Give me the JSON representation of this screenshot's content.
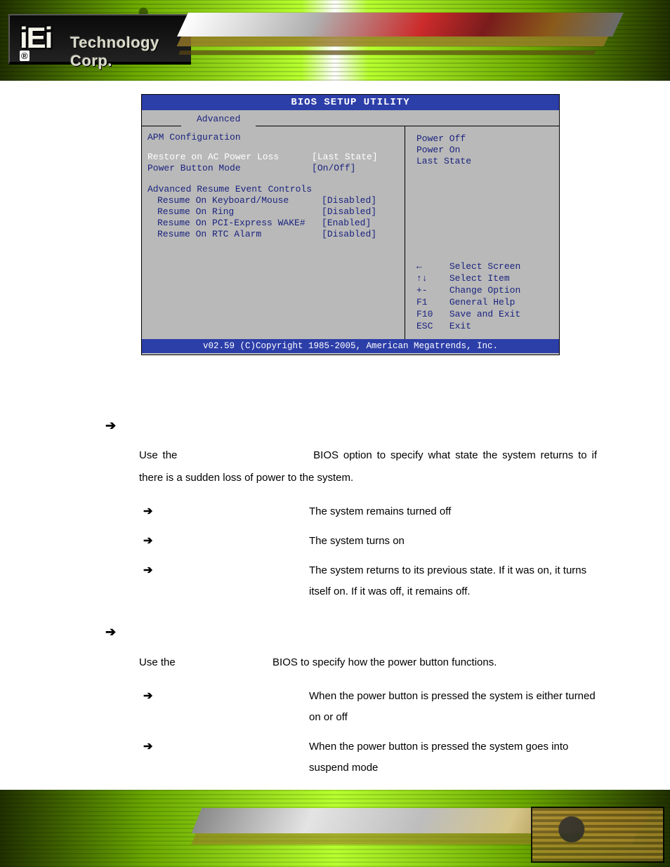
{
  "logo": {
    "brand": "iEi",
    "registered": "®",
    "tagline": "Technology Corp."
  },
  "bios": {
    "title": "BIOS SETUP UTILITY",
    "tab": "Advanced",
    "heading": "APM Configuration",
    "rows": {
      "restore": {
        "label": "Restore on AC Power Loss",
        "value": "[Last State]"
      },
      "pbm": {
        "label": "Power Button Mode",
        "value": "[On/Off]"
      },
      "arec_head": "Advanced Resume Event Controls",
      "kbm": {
        "label": "Resume On Keyboard/Mouse",
        "value": "[Disabled]"
      },
      "ring": {
        "label": "Resume On Ring",
        "value": "[Disabled]"
      },
      "pcie": {
        "label": "Resume On PCI-Express WAKE#",
        "value": "[Enabled]"
      },
      "rtc": {
        "label": "Resume On RTC Alarm",
        "value": "[Disabled]"
      }
    },
    "help_options": {
      "o1": "Power Off",
      "o2": "Power On",
      "o3": "Last State"
    },
    "keys": {
      "k1": {
        "key": "←",
        "lbl": "Select Screen"
      },
      "k2": {
        "key": "↑↓",
        "lbl": "Select Item"
      },
      "k3": {
        "key": "+-",
        "lbl": "Change Option"
      },
      "k4": {
        "key": "F1",
        "lbl": "General Help"
      },
      "k5": {
        "key": "F10",
        "lbl": "Save and Exit"
      },
      "k6": {
        "key": "ESC",
        "lbl": "Exit"
      }
    },
    "footer": "v02.59 (C)Copyright 1985-2005, American Megatrends, Inc."
  },
  "doc": {
    "sec1": {
      "intro_a": "Use the ",
      "intro_b": " BIOS option to specify what state the system returns to if there is a sudden loss of power to the system.",
      "opts": {
        "off": "The system remains turned off",
        "on": "The system turns on",
        "last": "The system returns to its previous state. If it was on, it turns itself on. If it was off, it remains off."
      }
    },
    "sec2": {
      "intro_a": "Use the ",
      "intro_b": " BIOS to specify how the power button functions.",
      "opts": {
        "onoff": "When the power button is pressed the system is either turned on or off",
        "suspend": "When the power button is pressed the system goes into suspend mode"
      }
    }
  }
}
